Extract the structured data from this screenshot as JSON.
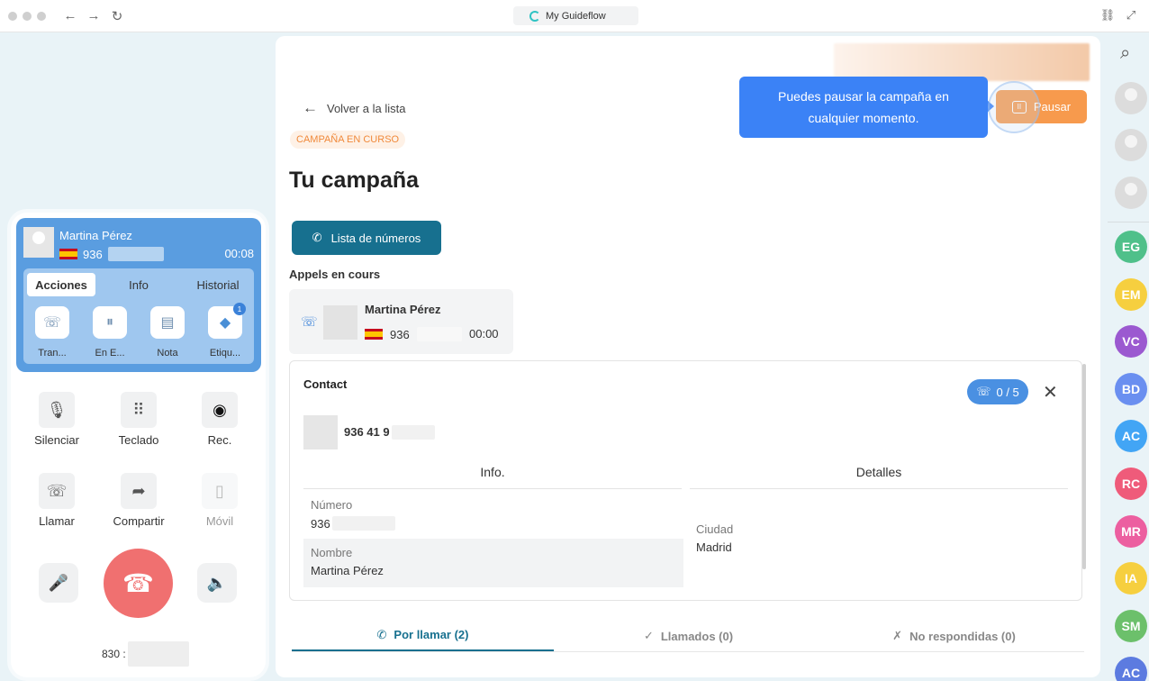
{
  "browser": {
    "tab_title": "My Guideflow"
  },
  "phone": {
    "caller_name": "Martina Pérez",
    "caller_number": "936",
    "duration": "00:08",
    "tabs": [
      "Acciones",
      "Info",
      "Historial"
    ],
    "actions": [
      {
        "label": "Tran...",
        "icon": "transfer-call-icon"
      },
      {
        "label": "En E...",
        "icon": "hold-pause-icon"
      },
      {
        "label": "Nota",
        "icon": "note-icon"
      },
      {
        "label": "Etiqu...",
        "icon": "tag-icon",
        "badge": "1"
      }
    ],
    "controls": [
      {
        "label": "Silenciar",
        "icon": "mute-icon"
      },
      {
        "label": "Teclado",
        "icon": "keypad-icon"
      },
      {
        "label": "Rec.",
        "icon": "record-icon"
      },
      {
        "label": "Llamar",
        "icon": "add-call-icon"
      },
      {
        "label": "Compartir",
        "icon": "share-icon"
      },
      {
        "label": "Móvil",
        "icon": "mobile-icon"
      }
    ],
    "footer_number": "830 :"
  },
  "main": {
    "back_label": "Volver a la lista",
    "status": "CAMPAÑA EN CURSO",
    "title": "Tu campaña",
    "list_button": "Lista de números",
    "section_label": "Appels en cours",
    "active_call": {
      "name": "Martina Pérez",
      "number": "936",
      "time": "00:00"
    },
    "contact": {
      "heading": "Contact",
      "counter": "0 / 5",
      "number": "936 41 9",
      "info_header": "Info.",
      "details_header": "Detalles",
      "fields": {
        "numero_label": "Número",
        "numero_value": "936",
        "nombre_label": "Nombre",
        "nombre_value": "Martina Pérez",
        "ciudad_label": "Ciudad",
        "ciudad_value": "Madrid"
      }
    },
    "bottom_tabs": [
      "Por llamar (2)",
      "Llamados (0)",
      "No respondidas (0)"
    ]
  },
  "tooltip": "Puedes pausar la campaña en cualquier momento.",
  "pause_button": "Pausar",
  "sidebar": {
    "avatars": [
      {
        "initials": "EG",
        "color": "#4fc08a"
      },
      {
        "initials": "EM",
        "color": "#f6cf3f"
      },
      {
        "initials": "VC",
        "color": "#9b59d0"
      },
      {
        "initials": "BD",
        "color": "#6a8ff0"
      },
      {
        "initials": "AC",
        "color": "#42a5f5"
      },
      {
        "initials": "RC",
        "color": "#ef5b7a"
      },
      {
        "initials": "MR",
        "color": "#ec5fa0"
      },
      {
        "initials": "IA",
        "color": "#f6cf3f"
      },
      {
        "initials": "SM",
        "color": "#6cc06b"
      },
      {
        "initials": "AC",
        "color": "#5c7be0"
      }
    ]
  }
}
